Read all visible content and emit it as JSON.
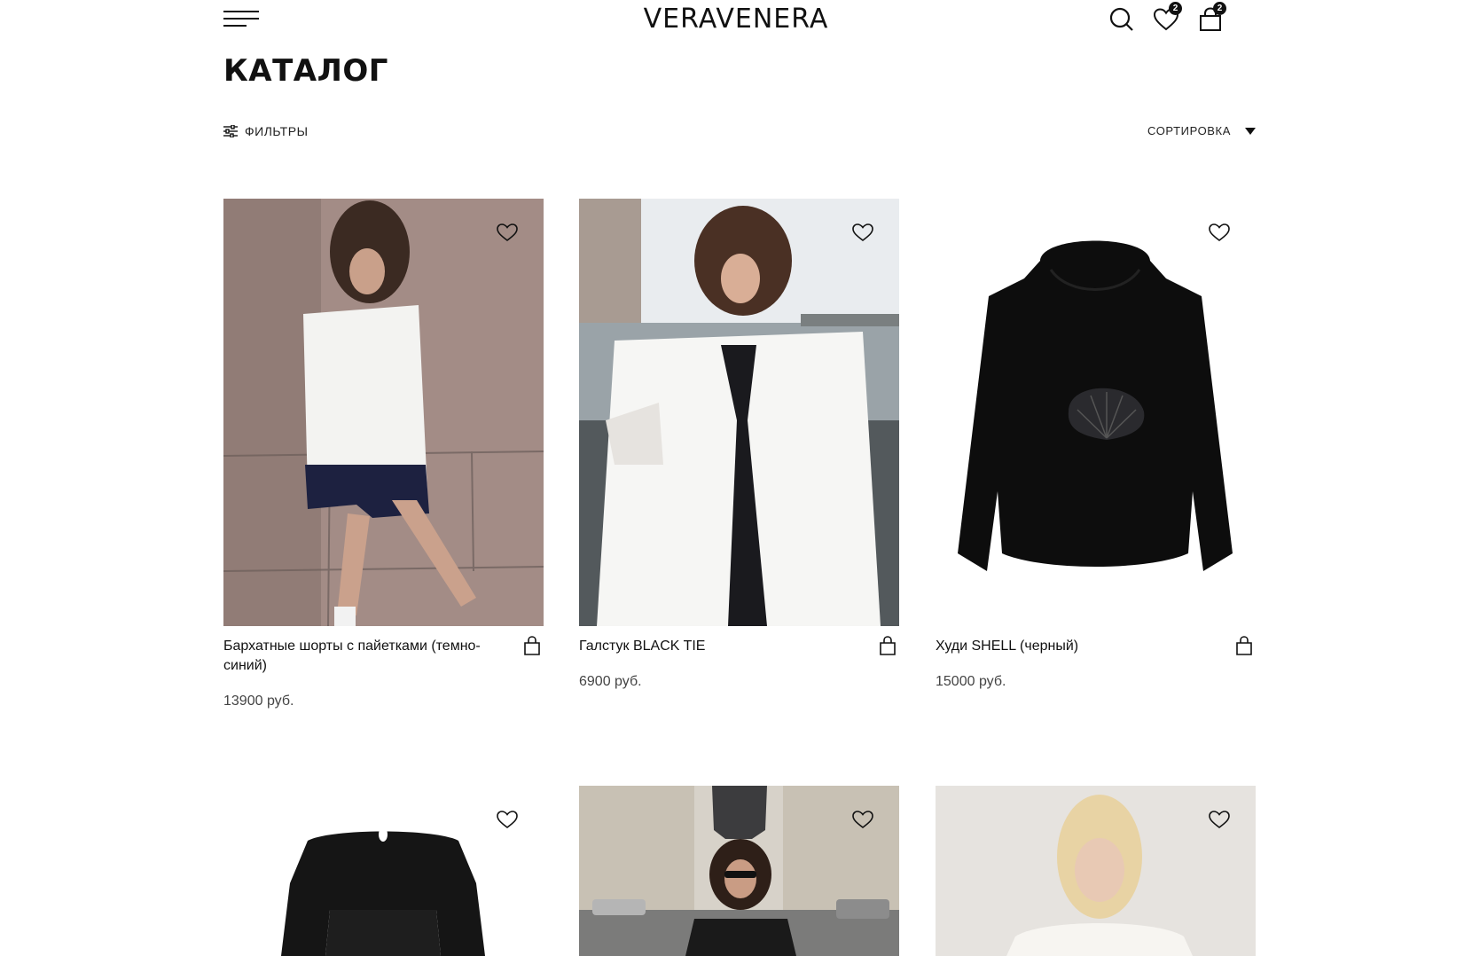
{
  "header": {
    "logo": "VERAVENERA",
    "wishlist_count": "2",
    "cart_count": "2",
    "icons": [
      "menu-icon",
      "search-icon",
      "heart-icon",
      "bag-icon"
    ]
  },
  "page": {
    "title": "КАТАЛОГ"
  },
  "toolbar": {
    "filters_label": "ФИЛЬТРЫ",
    "sort_label": "СОРТИРОВКА"
  },
  "products": [
    {
      "title": "Бархатные шорты с пайетками (темно-синий)",
      "price": "13900 руб."
    },
    {
      "title": "Галстук BLACK TIE",
      "price": "6900 руб."
    },
    {
      "title": "Худи SHELL (черный)",
      "price": "15000 руб."
    },
    {
      "title": "",
      "price": ""
    },
    {
      "title": "",
      "price": ""
    },
    {
      "title": "",
      "price": ""
    }
  ],
  "colors": {
    "text": "#111111",
    "price": "#444444",
    "background": "#ffffff"
  }
}
